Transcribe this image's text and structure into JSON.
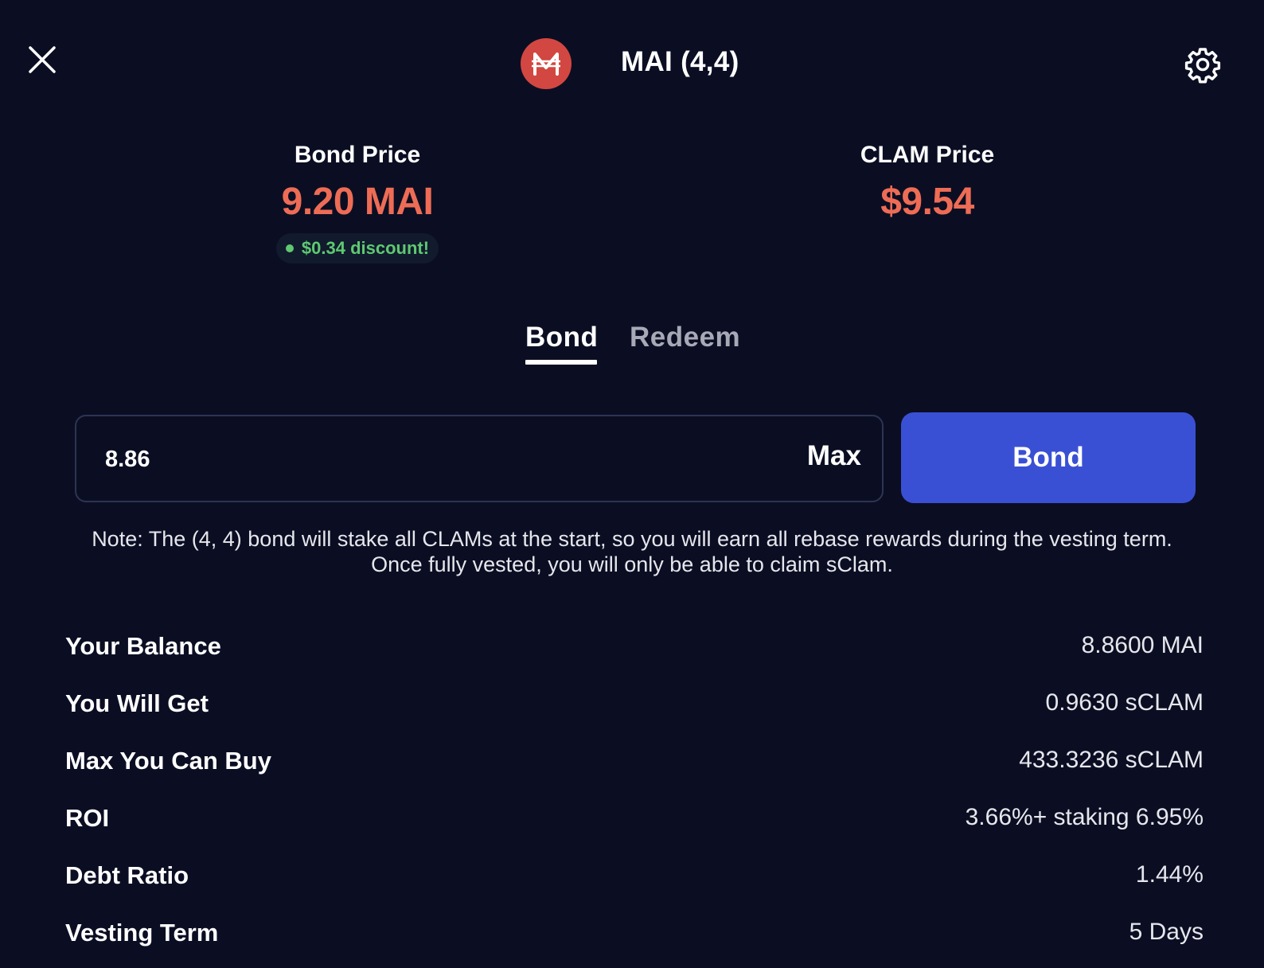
{
  "header": {
    "title": "MAI (4,4)",
    "logo_glyph": "₼",
    "logo_color": "#d24741",
    "close_icon": "close-icon",
    "settings_icon": "gear-icon"
  },
  "prices": {
    "bond_price_label": "Bond Price",
    "bond_price_value": "9.20 MAI",
    "discount_text": "$0.34 discount!",
    "clam_price_label": "CLAM Price",
    "clam_price_value": "$9.54"
  },
  "tabs": [
    {
      "label": "Bond",
      "active": true
    },
    {
      "label": "Redeem",
      "active": false
    }
  ],
  "form": {
    "amount_value": "8.86",
    "max_label": "Max",
    "submit_label": "Bond"
  },
  "note": {
    "line1": "Note: The (4, 4) bond will stake all CLAMs at the start, so you will earn all rebase rewards during the vesting term.",
    "line2": "Once fully vested, you will only be able to claim sClam."
  },
  "details": [
    {
      "label": "Your Balance",
      "value": "8.8600 MAI"
    },
    {
      "label": "You Will Get",
      "value": "0.9630 sCLAM"
    },
    {
      "label": "Max You Can Buy",
      "value": "433.3236 sCLAM"
    },
    {
      "label": "ROI",
      "value": "3.66%+ staking 6.95%"
    },
    {
      "label": "Debt Ratio",
      "value": "1.44%"
    },
    {
      "label": "Vesting Term",
      "value": "5 Days"
    }
  ],
  "colors": {
    "background": "#0b0e23",
    "accent_price": "#ee6c55",
    "discount_green": "#5ec971",
    "primary_button": "#3a50d4"
  }
}
